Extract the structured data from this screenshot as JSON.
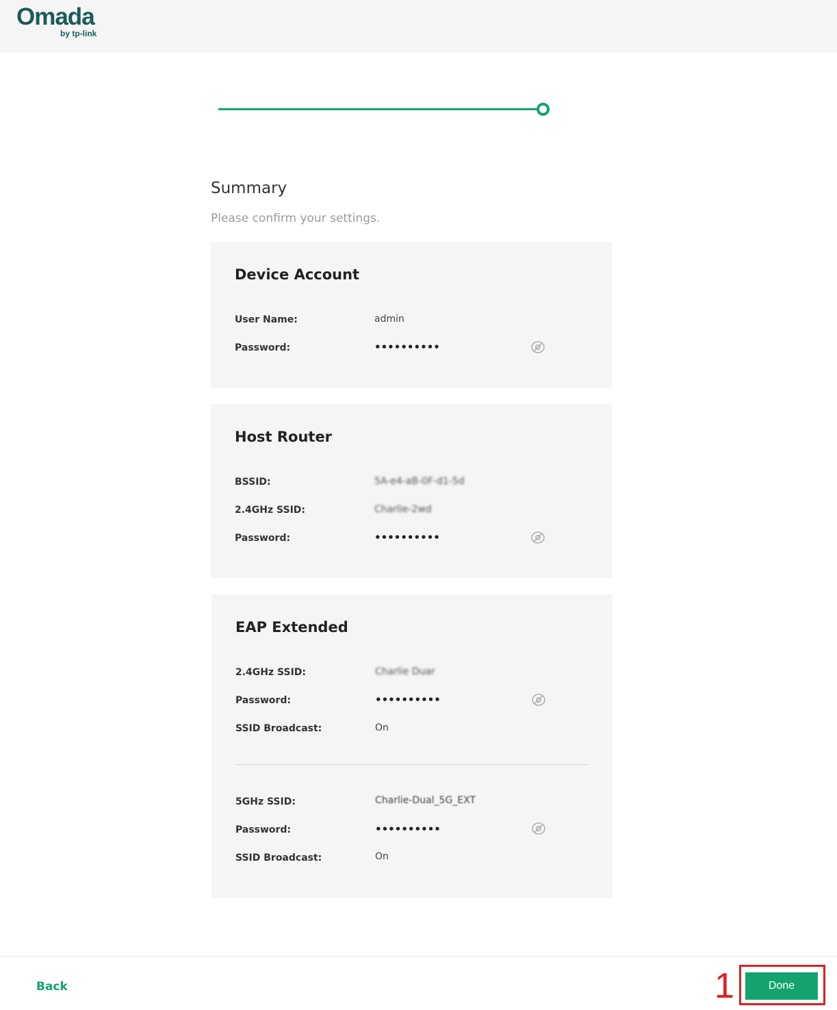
{
  "brand": {
    "name": "Omada",
    "tagline": "by tp-link",
    "accent": "#14a36f"
  },
  "wizard": {
    "progress_percent": 100
  },
  "summary": {
    "title": "Summary",
    "subtitle": "Please confirm your settings."
  },
  "device_account": {
    "title": "Device Account",
    "user_name_label": "User Name:",
    "user_name_value": "admin",
    "password_label": "Password:",
    "password_value": "••••••••••",
    "reveal_icon": "eye-off-icon"
  },
  "host_router": {
    "title": "Host Router",
    "bssid_label": "BSSID:",
    "bssid_value": "5A-e4-aB-0F-d1-5d",
    "ssid24_label": "2.4GHz SSID:",
    "ssid24_value": "Charlie-2wd",
    "password_label": "Password:",
    "password_value": "••••••••••"
  },
  "eap_extended": {
    "title": "EAP Extended",
    "ssid24_label": "2.4GHz SSID:",
    "ssid24_value": "Charlie Duar",
    "password24_label": "Password:",
    "password24_value": "••••••••••",
    "broadcast24_label": "SSID Broadcast:",
    "broadcast24_value": "On",
    "ssid5_label": "5GHz SSID:",
    "ssid5_value": "Charlie-Dual_5G_EXT",
    "password5_label": "Password:",
    "password5_value": "••••••••••",
    "broadcast5_label": "SSID Broadcast:",
    "broadcast5_value": "On"
  },
  "footer": {
    "back_label": "Back",
    "done_label": "Done"
  },
  "annotation": {
    "step_number": "1",
    "color": "#e02020"
  }
}
